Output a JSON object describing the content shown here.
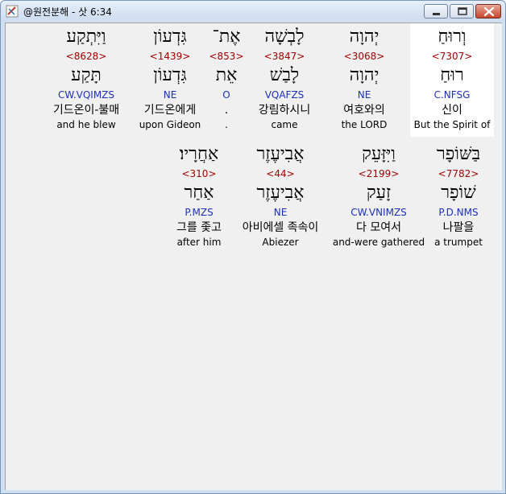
{
  "window": {
    "title": "@원전분해 - 삿 6:34",
    "app_icon": "bible-app-icon",
    "controls": [
      "minimize-icon",
      "maximize-icon",
      "close-icon"
    ]
  },
  "rows": [
    [
      {
        "surface": "וְרוּחַ",
        "strong": "<7307>",
        "lemma": "רוּחַ",
        "morph": "C.NFSG",
        "korean": "신이",
        "english": "But the Spirit of",
        "selected": true
      },
      {
        "surface": "יְהוָה",
        "strong": "<3068>",
        "lemma": "יְהוָה",
        "morph": "NE",
        "korean": "여호와의",
        "english": "the LORD"
      },
      {
        "surface": "לָבְשָׁה",
        "strong": "<3847>",
        "lemma": "לָבַשׁ",
        "morph": "VQAFZS",
        "korean": "강림하시니",
        "english": "came"
      },
      {
        "surface": "אֶת־",
        "strong": "<853>",
        "lemma": "אֵת",
        "morph": "O",
        "korean": ".",
        "english": "."
      },
      {
        "surface": "גִּדְעוֹן",
        "strong": "<1439>",
        "lemma": "גִּדְעוֹן",
        "morph": "NE",
        "korean": "기드온에게",
        "english": "upon Gideon"
      },
      {
        "surface": "וַיִּתְקַע",
        "strong": "<8628>",
        "lemma": "תָּקַע",
        "morph": "CW.VQIMZS",
        "korean": "기드온이-불매",
        "english": "and he blew"
      }
    ],
    [
      {
        "surface": "בַּשּׁוֹפָר",
        "strong": "<7782>",
        "lemma": "שׁוֹפָר",
        "morph": "P.D.NMS",
        "korean": "나팔을",
        "english": "a trumpet"
      },
      {
        "surface": "וַיִּזָּעֵק",
        "strong": "<2199>",
        "lemma": "זָעַק",
        "morph": "CW.VNIMZS",
        "korean": "다 모여서",
        "english": "and-were gathered"
      },
      {
        "surface": "אֲבִיעֶזֶר",
        "strong": "<44>",
        "lemma": "אֲבִיעֶזֶר",
        "morph": "NE",
        "korean": "아비에셀 족속이",
        "english": "Abiezer"
      },
      {
        "surface": "אַחֲרָיו׃",
        "strong": "<310>",
        "lemma": "אַחַר",
        "morph": "P.MZS",
        "korean": "그를 좇고",
        "english": "after him"
      }
    ]
  ]
}
